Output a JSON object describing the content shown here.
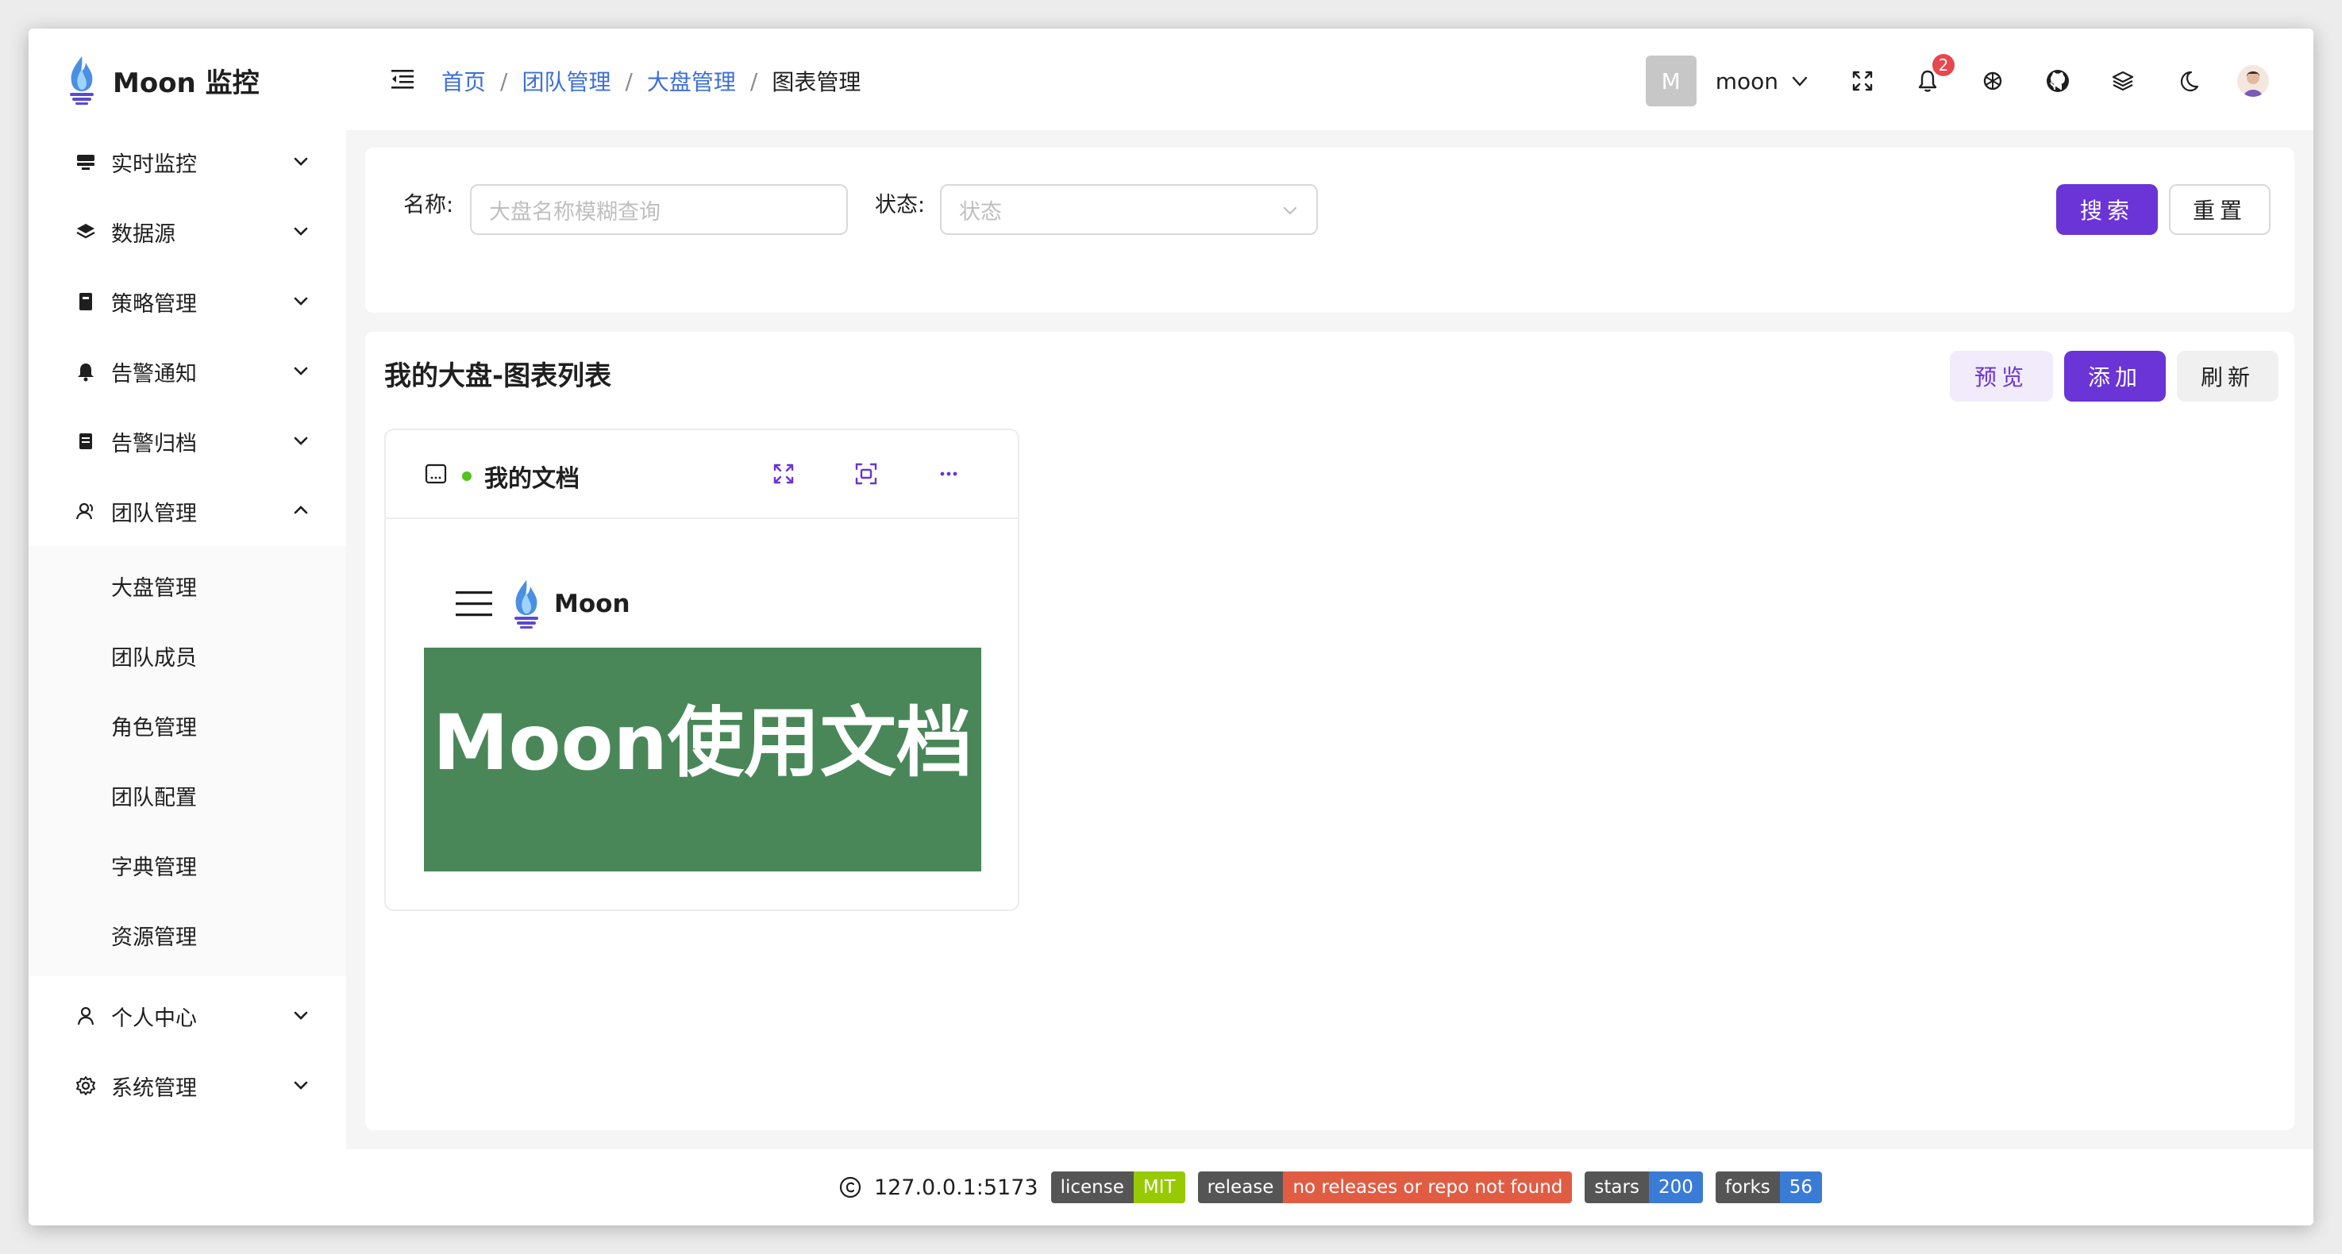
{
  "app": {
    "title": "Moon 监控",
    "brand_color": "#6a34d6"
  },
  "sidebar": {
    "items": [
      {
        "label": "实时监控",
        "icon": "monitor-icon"
      },
      {
        "label": "数据源",
        "icon": "database-layers-icon"
      },
      {
        "label": "策略管理",
        "icon": "strategy-book-icon"
      },
      {
        "label": "告警通知",
        "icon": "bell-icon"
      },
      {
        "label": "告警归档",
        "icon": "archive-icon"
      },
      {
        "label": "团队管理",
        "icon": "team-icon",
        "expanded": true
      }
    ],
    "team_sub": [
      {
        "label": "大盘管理"
      },
      {
        "label": "团队成员"
      },
      {
        "label": "角色管理"
      },
      {
        "label": "团队配置"
      },
      {
        "label": "字典管理"
      },
      {
        "label": "资源管理"
      }
    ],
    "lower": [
      {
        "label": "个人中心",
        "icon": "user-icon"
      },
      {
        "label": "系统管理",
        "icon": "settings-gear-icon"
      }
    ]
  },
  "header": {
    "breadcrumb": [
      "首页",
      "团队管理",
      "大盘管理"
    ],
    "breadcrumb_current": "图表管理",
    "separator": "/",
    "user_initial": "M",
    "user_name": "moon",
    "notification_count": "2"
  },
  "search": {
    "name_label": "名称:",
    "name_placeholder": "大盘名称模糊查询",
    "status_label": "状态:",
    "status_placeholder": "状态",
    "search_button": "搜索",
    "reset_button": "重置"
  },
  "list": {
    "title": "我的大盘-图表列表",
    "preview_button": "预览",
    "add_button": "添加",
    "refresh_button": "刷新",
    "charts": [
      {
        "title": "我的文档",
        "status_color": "#52c41a",
        "preview_brand": "Moon",
        "preview_hero": "Moon使用文档"
      }
    ]
  },
  "footer": {
    "host": "127.0.0.1:5173",
    "badges": [
      {
        "label": "license",
        "value": "MIT",
        "color": "#97ca00"
      },
      {
        "label": "release",
        "value": "no releases or repo not found",
        "color": "#e05d44"
      },
      {
        "label": "stars",
        "value": "200",
        "color": "#3a7bd5"
      },
      {
        "label": "forks",
        "value": "56",
        "color": "#3a7bd5"
      }
    ]
  }
}
